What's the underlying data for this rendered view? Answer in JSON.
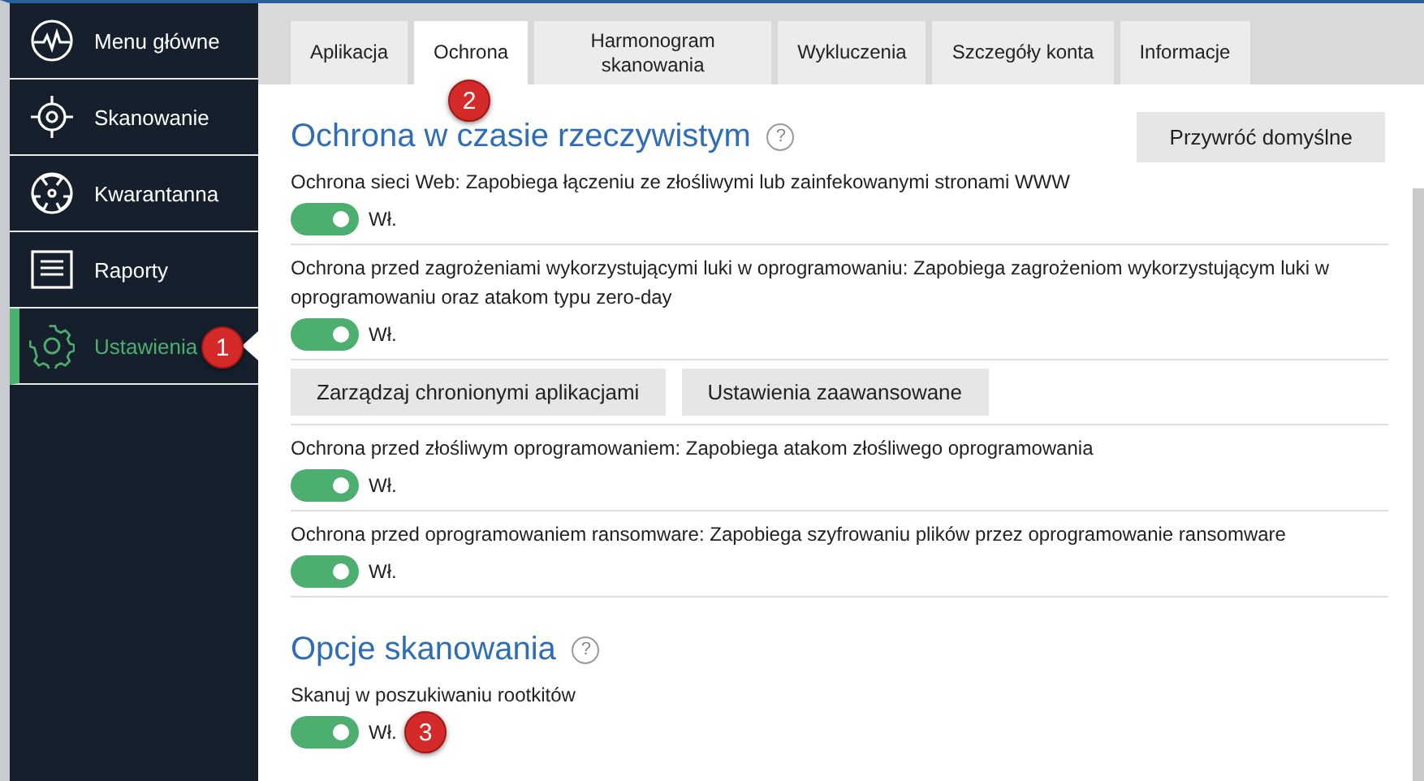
{
  "sidebar": {
    "items": [
      {
        "label": "Menu główne",
        "selected": false
      },
      {
        "label": "Skanowanie",
        "selected": false
      },
      {
        "label": "Kwarantanna",
        "selected": false
      },
      {
        "label": "Raporty",
        "selected": false
      },
      {
        "label": "Ustawienia",
        "selected": true,
        "callout": "1"
      }
    ]
  },
  "tabs": [
    {
      "label": "Aplikacja",
      "selected": false
    },
    {
      "label": "Ochrona",
      "selected": true,
      "callout": "2"
    },
    {
      "label": "Harmonogram skanowania",
      "selected": false
    },
    {
      "label": "Wykluczenia",
      "selected": false
    },
    {
      "label": "Szczegóły konta",
      "selected": false
    },
    {
      "label": "Informacje",
      "selected": false
    }
  ],
  "sections": [
    {
      "title": "Ochrona w czasie rzeczywistym",
      "help": "?",
      "reset_button": "Przywróć domyślne",
      "items": [
        {
          "kind": "toggle",
          "label": "Ochrona sieci Web: Zapobiega łączeniu ze złośliwymi lub zainfekowanymi stronami WWW",
          "on": true,
          "state_label": "Wł."
        },
        {
          "kind": "toggle",
          "label": "Ochrona przed zagrożeniami wykorzystującymi luki w oprogramowaniu: Zapobiega zagrożeniom wykorzystującym luki w oprogramowaniu oraz atakom typu zero-day",
          "on": true,
          "state_label": "Wł."
        },
        {
          "kind": "buttons",
          "buttons": [
            "Zarządzaj chronionymi aplikacjami",
            "Ustawienia zaawansowane"
          ]
        },
        {
          "kind": "toggle",
          "label": "Ochrona przed złośliwym oprogramowaniem: Zapobiega atakom złośliwego oprogramowania",
          "on": true,
          "state_label": "Wł."
        },
        {
          "kind": "toggle",
          "label": "Ochrona przed oprogramowaniem ransomware: Zapobiega szyfrowaniu plików przez oprogramowanie ransomware",
          "on": true,
          "state_label": "Wł."
        }
      ]
    },
    {
      "title": "Opcje skanowania",
      "help": "?",
      "items": [
        {
          "kind": "toggle",
          "label": "Skanuj w poszukiwaniu rootkitów",
          "on": true,
          "state_label": "Wł.",
          "callout": "3"
        }
      ]
    }
  ]
}
